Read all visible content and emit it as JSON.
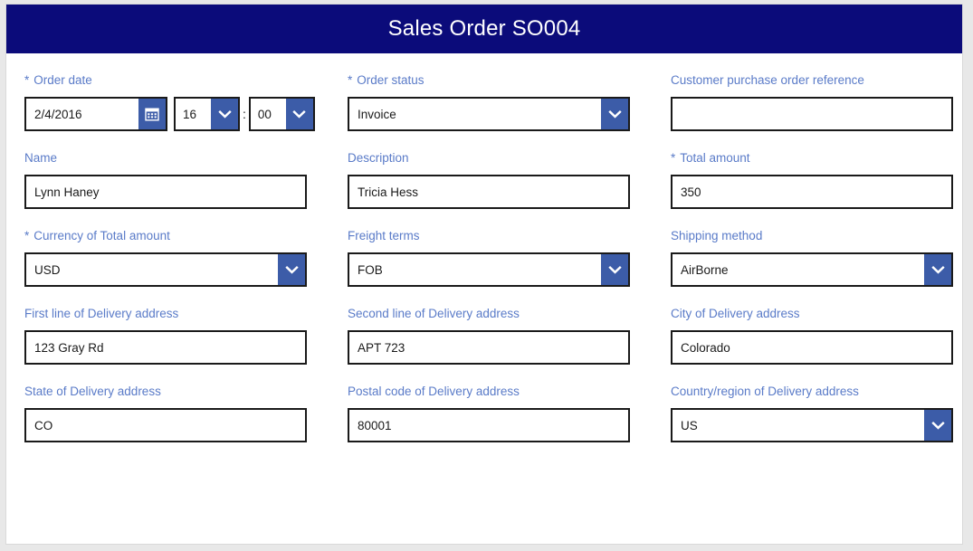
{
  "header": {
    "title": "Sales Order SO004"
  },
  "form": {
    "rows": [
      {
        "fields": [
          {
            "name": "order-date",
            "label": "Order date",
            "required": true,
            "type": "datetime",
            "value": "2/4/2016",
            "hour": "16",
            "separator": ":",
            "minute": "00",
            "icon": "calendar-icon"
          },
          {
            "name": "order-status",
            "label": "Order status",
            "required": true,
            "type": "select",
            "value": "Invoice",
            "icon": "chevron-down-icon"
          },
          {
            "name": "customer-purchase-order-reference",
            "label": "Customer purchase order reference",
            "required": false,
            "type": "text",
            "value": ""
          }
        ]
      },
      {
        "fields": [
          {
            "name": "name",
            "label": "Name",
            "required": false,
            "type": "text",
            "value": "Lynn Haney"
          },
          {
            "name": "description",
            "label": "Description",
            "required": false,
            "type": "text",
            "value": "Tricia Hess"
          },
          {
            "name": "total-amount",
            "label": "Total amount",
            "required": true,
            "type": "text",
            "value": "350"
          }
        ]
      },
      {
        "fields": [
          {
            "name": "currency-of-total-amount",
            "label": "Currency of Total amount",
            "required": true,
            "type": "select",
            "value": "USD",
            "icon": "chevron-down-icon"
          },
          {
            "name": "freight-terms",
            "label": "Freight terms",
            "required": false,
            "type": "select",
            "value": "FOB",
            "icon": "chevron-down-icon"
          },
          {
            "name": "shipping-method",
            "label": "Shipping method",
            "required": false,
            "type": "select",
            "value": "AirBorne",
            "icon": "chevron-down-icon"
          }
        ]
      },
      {
        "fields": [
          {
            "name": "first-line-of-delivery-address",
            "label": "First line of Delivery address",
            "required": false,
            "type": "text",
            "value": "123 Gray Rd"
          },
          {
            "name": "second-line-of-delivery-address",
            "label": "Second line of Delivery address",
            "required": false,
            "type": "text",
            "value": "APT 723"
          },
          {
            "name": "city-of-delivery-address",
            "label": "City of Delivery address",
            "required": false,
            "type": "text",
            "value": "Colorado"
          }
        ]
      },
      {
        "fields": [
          {
            "name": "state-of-delivery-address",
            "label": "State of Delivery address",
            "required": false,
            "type": "text",
            "value": "CO"
          },
          {
            "name": "postal-code-of-delivery-address",
            "label": "Postal code of Delivery address",
            "required": false,
            "type": "text",
            "value": "80001"
          },
          {
            "name": "country-region-of-delivery-address",
            "label": "Country/region of Delivery address",
            "required": false,
            "type": "select",
            "value": "US",
            "icon": "chevron-down-icon"
          }
        ]
      }
    ],
    "required_marker": "*"
  },
  "colors": {
    "title_bar": "#0b0b7a",
    "label": "#5a7bc8",
    "accent_button": "#3c5ca8",
    "field_border": "#1a1a1a",
    "page_background": "#e8e8e8"
  }
}
